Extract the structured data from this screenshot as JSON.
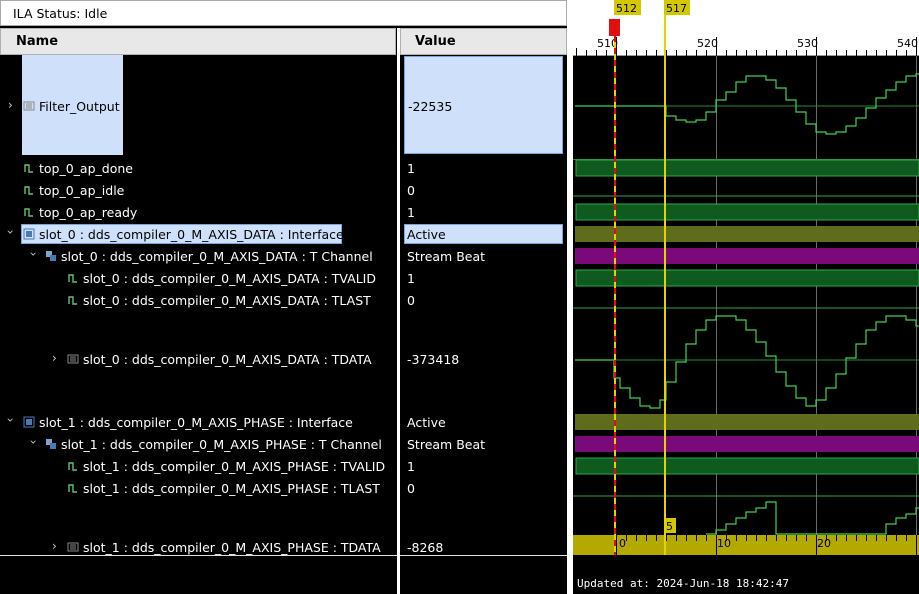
{
  "status": {
    "label": "ILA Status:",
    "value": "Idle"
  },
  "columns": {
    "name": "Name",
    "value": "Value"
  },
  "signals": [
    {
      "name": "Filter_Output",
      "value": "-22535",
      "icon": "bus-icon"
    },
    {
      "name": "top_0_ap_done",
      "value": "1",
      "icon": "bit-icon"
    },
    {
      "name": "top_0_ap_idle",
      "value": "0",
      "icon": "bit-icon"
    },
    {
      "name": "top_0_ap_ready",
      "value": "1",
      "icon": "bit-icon"
    },
    {
      "name": "slot_0 : dds_compiler_0_M_AXIS_DATA : Interface",
      "value": "Active",
      "icon": "interface-icon"
    },
    {
      "name": "slot_0 : dds_compiler_0_M_AXIS_DATA : T Channel",
      "value": "Stream Beat",
      "icon": "channel-icon"
    },
    {
      "name": "slot_0 : dds_compiler_0_M_AXIS_DATA : TVALID",
      "value": "1",
      "icon": "bit-icon"
    },
    {
      "name": "slot_0 : dds_compiler_0_M_AXIS_DATA : TLAST",
      "value": "0",
      "icon": "bit-icon"
    },
    {
      "name": "slot_0 : dds_compiler_0_M_AXIS_DATA : TDATA",
      "value": "-373418",
      "icon": "bus-icon"
    },
    {
      "name": "slot_1 : dds_compiler_0_M_AXIS_PHASE : Interface",
      "value": "Active",
      "icon": "interface-icon"
    },
    {
      "name": "slot_1 : dds_compiler_0_M_AXIS_PHASE : T Channel",
      "value": "Stream Beat",
      "icon": "channel-icon"
    },
    {
      "name": "slot_1 : dds_compiler_0_M_AXIS_PHASE : TVALID",
      "value": "1",
      "icon": "bit-icon"
    },
    {
      "name": "slot_1 : dds_compiler_0_M_AXIS_PHASE : TLAST",
      "value": "0",
      "icon": "bit-icon"
    },
    {
      "name": "slot_1 : dds_compiler_0_M_AXIS_PHASE : TDATA",
      "value": "-8268",
      "icon": "bus-icon"
    }
  ],
  "waveform": {
    "markers": [
      "512",
      "517"
    ],
    "ticks": [
      "510",
      "520",
      "530",
      "540"
    ],
    "sample_ticks": [
      "0",
      "10",
      "20"
    ],
    "window_marker_label": "5",
    "colors": {
      "bit_green": "#0e5a1f",
      "bit_green_edge": "#2ea84a",
      "interface_olive": "#5f6c1b",
      "channel_purple": "#7a0a7a",
      "cursor_yellow": "#e2d400",
      "trigger_red": "#e01010",
      "ruler_olive": "#b4a900"
    }
  },
  "footer": {
    "updated_label": "Updated at:",
    "updated_time": "2024-Jun-18 18:42:47"
  }
}
